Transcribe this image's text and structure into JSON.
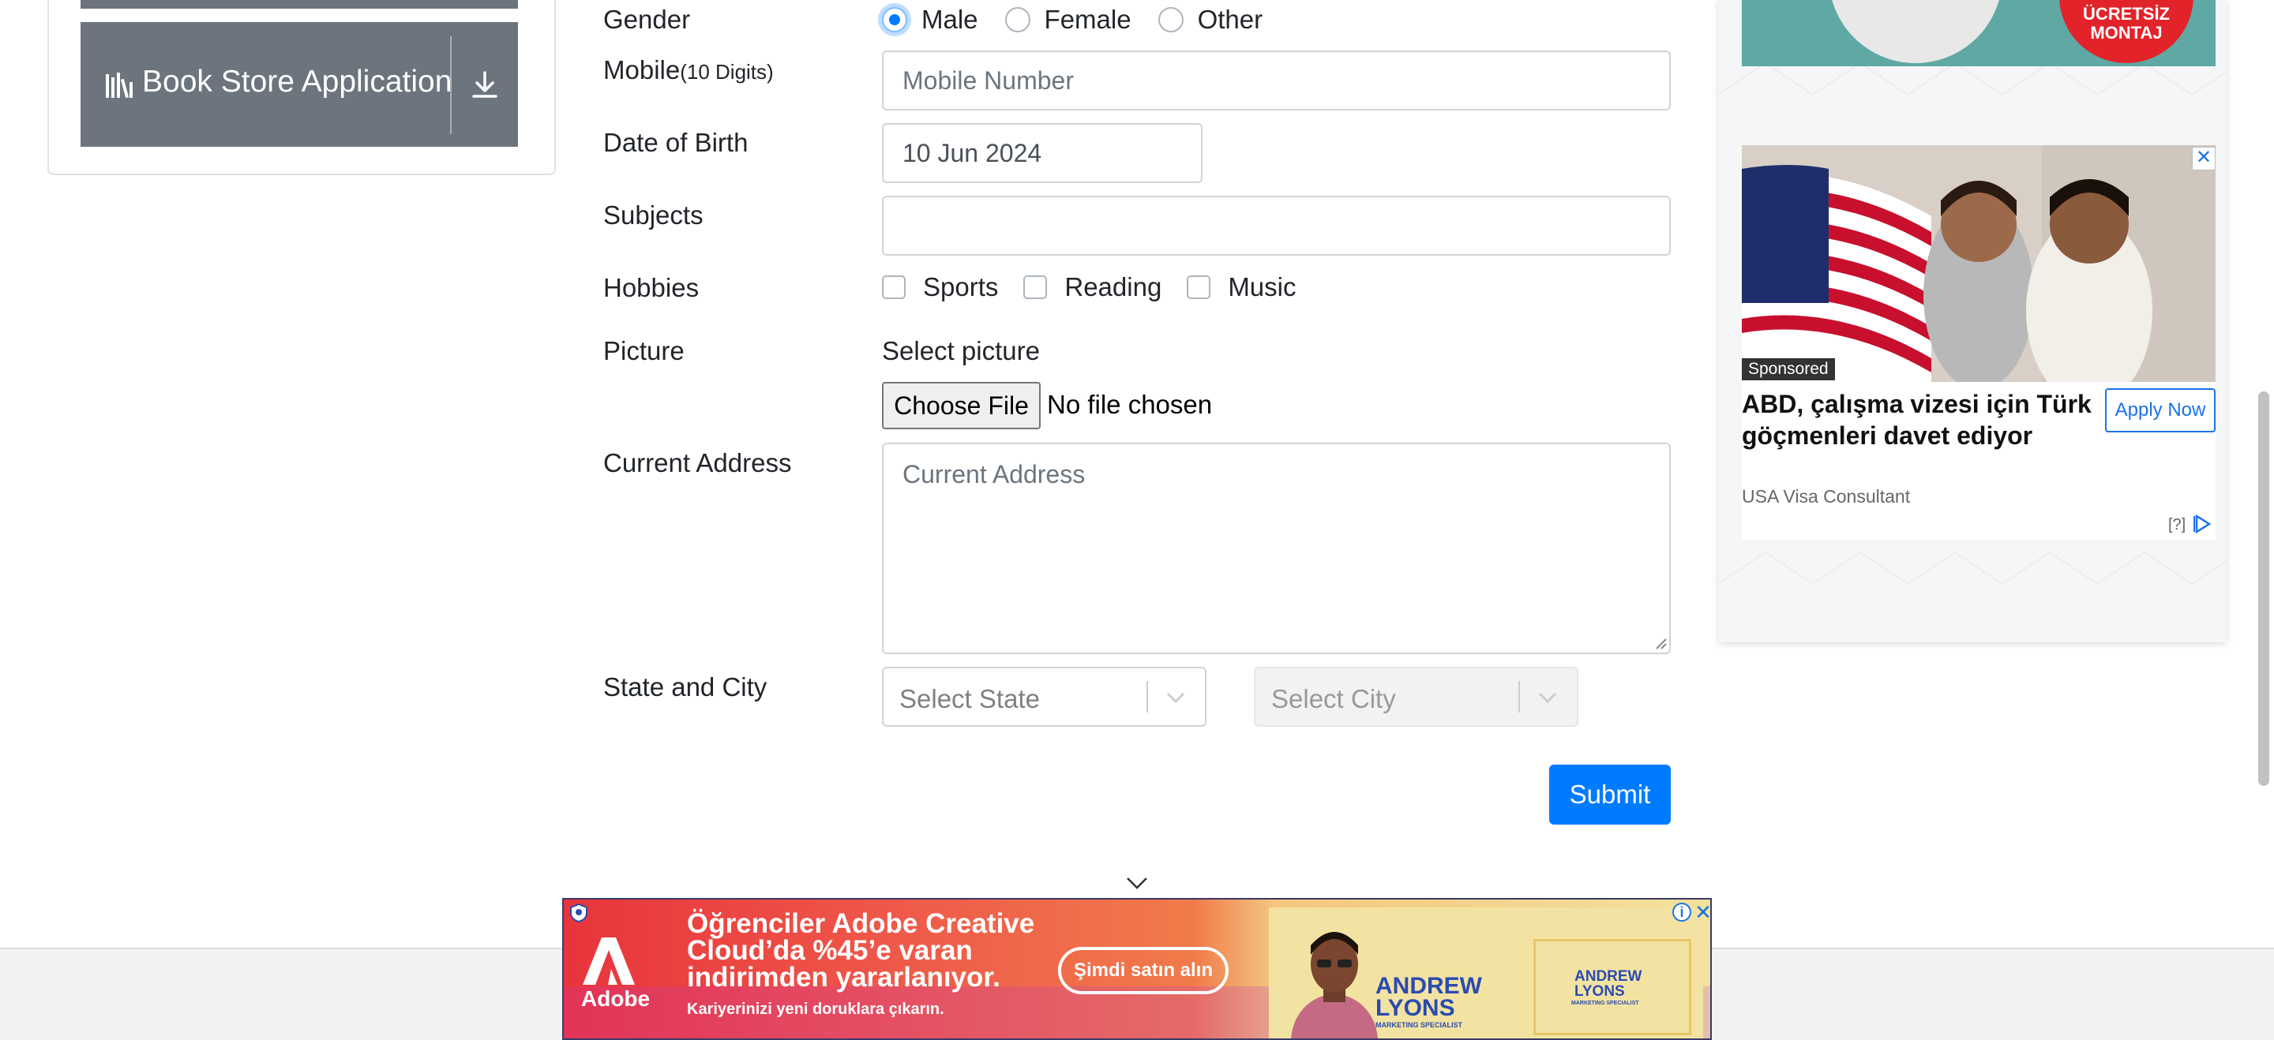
{
  "sidebar": {
    "book_store_label": "Book Store Application"
  },
  "form": {
    "gender": {
      "label": "Gender",
      "options": [
        "Male",
        "Female",
        "Other"
      ],
      "selected": "Male"
    },
    "mobile": {
      "label": "Mobile",
      "label_hint": "(10 Digits)",
      "placeholder": "Mobile Number"
    },
    "dob": {
      "label": "Date of Birth",
      "value": "10 Jun 2024"
    },
    "subjects": {
      "label": "Subjects",
      "value": ""
    },
    "hobbies": {
      "label": "Hobbies",
      "options": [
        "Sports",
        "Reading",
        "Music"
      ]
    },
    "picture": {
      "label": "Picture",
      "prompt": "Select picture",
      "button": "Choose File",
      "status": "No file chosen"
    },
    "address": {
      "label": "Current Address",
      "placeholder": "Current Address"
    },
    "state_city": {
      "label": "State and City",
      "state_placeholder": "Select State",
      "city_placeholder": "Select City"
    },
    "submit_label": "Submit"
  },
  "right_ads": {
    "top_badge": "ÜCRETSİZ\nMONTAJ",
    "sponsored": "Sponsored",
    "headline": "ABD, çalışma vizesi için Türk göçmenleri davet ediyor",
    "cta": "Apply Now",
    "advertiser": "USA Visa Consultant",
    "info": "[?]"
  },
  "bottom_ad": {
    "brand": "Adobe",
    "headline": "Öğrenciler Adobe Creative Cloud’da %45’e varan indirimden yararlanıyor.",
    "subline": "Kariyerinizi yeni doruklara çıkarın.",
    "cta": "Şimdi satın alın",
    "name": "ANDREW\nLYONS",
    "role": "MARKETING SPECIALIST"
  },
  "colors": {
    "primary": "#007bff",
    "sidebar_item": "#6c757d",
    "ad_link": "#1a73e8"
  }
}
